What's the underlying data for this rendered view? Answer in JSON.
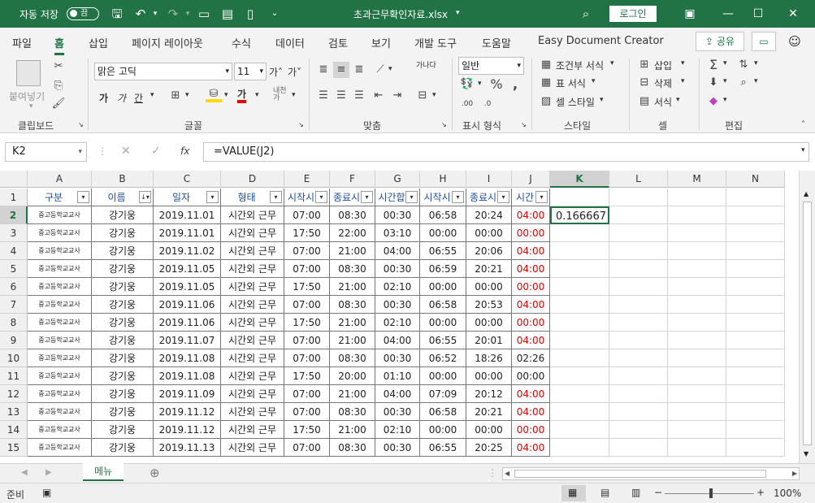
{
  "titlebar": {
    "autosave": "자동 저장",
    "autosave_state": "끔",
    "filename": "초과근무확인자료.xlsx",
    "login": "로그인"
  },
  "tabs": [
    "파일",
    "홈",
    "삽입",
    "페이지 레이아웃",
    "수식",
    "데이터",
    "검토",
    "보기",
    "개발 도구",
    "도움말",
    "Easy Document Creator"
  ],
  "share": "공유",
  "ribbon": {
    "paste": "붙여넣기",
    "font_name": "맑은 고딕",
    "font_size": "11",
    "bold": "가",
    "italic": "가",
    "underline": "간",
    "font_a": "가",
    "grow": "가˄",
    "shrink": "가˅",
    "numfmt": "일반",
    "wrap": "가나다",
    "cond": "조건부 서식",
    "tablefmt": "표 서식",
    "cellstyle": "셀 스타일",
    "insert": "삽입",
    "delete": "삭제",
    "format": "서식",
    "groups": {
      "clipboard": "클립보드",
      "font": "글꼴",
      "align": "맞춤",
      "number": "표시 형식",
      "style": "스타일",
      "cells": "셀",
      "edit": "편집"
    }
  },
  "namebox": "K2",
  "formula": "=VALUE(J2)",
  "columns": [
    "A",
    "B",
    "C",
    "D",
    "E",
    "F",
    "G",
    "H",
    "I",
    "J",
    "K",
    "L",
    "M",
    "N"
  ],
  "headers": [
    "구분",
    "이름",
    "일자",
    "형태",
    "시작시",
    "종료시",
    "시간합",
    "시작시",
    "종료시",
    "시간"
  ],
  "rows": [
    {
      "n": "1"
    },
    {
      "n": "2",
      "a": "중고등학교교사",
      "b": "강기웅",
      "c": "2019.11.01",
      "d": "시간외 근무",
      "e": "07:00",
      "f": "08:30",
      "g": "00:30",
      "h": "06:58",
      "i": "20:24",
      "j": "04:00",
      "jred": true,
      "k": "0.166667"
    },
    {
      "n": "3",
      "a": "중고등학교교사",
      "b": "강기웅",
      "c": "2019.11.01",
      "d": "시간외 근무",
      "e": "17:50",
      "f": "22:00",
      "g": "03:10",
      "h": "00:00",
      "i": "00:00",
      "j": "00:00",
      "jred": true
    },
    {
      "n": "4",
      "a": "중고등학교교사",
      "b": "강기웅",
      "c": "2019.11.02",
      "d": "시간외 근무",
      "e": "07:00",
      "f": "21:00",
      "g": "04:00",
      "h": "06:55",
      "i": "20:06",
      "j": "04:00",
      "jred": true
    },
    {
      "n": "5",
      "a": "중고등학교교사",
      "b": "강기웅",
      "c": "2019.11.05",
      "d": "시간외 근무",
      "e": "07:00",
      "f": "08:30",
      "g": "00:30",
      "h": "06:59",
      "i": "20:21",
      "j": "04:00",
      "jred": true
    },
    {
      "n": "6",
      "a": "중고등학교교사",
      "b": "강기웅",
      "c": "2019.11.05",
      "d": "시간외 근무",
      "e": "17:50",
      "f": "21:00",
      "g": "02:10",
      "h": "00:00",
      "i": "00:00",
      "j": "00:00",
      "jred": true
    },
    {
      "n": "7",
      "a": "중고등학교교사",
      "b": "강기웅",
      "c": "2019.11.06",
      "d": "시간외 근무",
      "e": "07:00",
      "f": "08:30",
      "g": "00:30",
      "h": "06:58",
      "i": "20:53",
      "j": "04:00",
      "jred": true
    },
    {
      "n": "8",
      "a": "중고등학교교사",
      "b": "강기웅",
      "c": "2019.11.06",
      "d": "시간외 근무",
      "e": "17:50",
      "f": "21:00",
      "g": "02:10",
      "h": "00:00",
      "i": "00:00",
      "j": "00:00",
      "jred": true
    },
    {
      "n": "9",
      "a": "중고등학교교사",
      "b": "강기웅",
      "c": "2019.11.07",
      "d": "시간외 근무",
      "e": "07:00",
      "f": "21:00",
      "g": "04:00",
      "h": "06:55",
      "i": "20:01",
      "j": "04:00",
      "jred": true
    },
    {
      "n": "10",
      "a": "중고등학교교사",
      "b": "강기웅",
      "c": "2019.11.08",
      "d": "시간외 근무",
      "e": "07:00",
      "f": "08:30",
      "g": "00:30",
      "h": "06:52",
      "i": "18:26",
      "j": "02:26",
      "jred": false
    },
    {
      "n": "11",
      "a": "중고등학교교사",
      "b": "강기웅",
      "c": "2019.11.08",
      "d": "시간외 근무",
      "e": "17:50",
      "f": "20:00",
      "g": "01:10",
      "h": "00:00",
      "i": "00:00",
      "j": "00:00",
      "jred": false
    },
    {
      "n": "12",
      "a": "중고등학교교사",
      "b": "강기웅",
      "c": "2019.11.09",
      "d": "시간외 근무",
      "e": "07:00",
      "f": "21:00",
      "g": "04:00",
      "h": "07:09",
      "i": "20:12",
      "j": "04:00",
      "jred": true
    },
    {
      "n": "13",
      "a": "중고등학교교사",
      "b": "강기웅",
      "c": "2019.11.12",
      "d": "시간외 근무",
      "e": "07:00",
      "f": "08:30",
      "g": "00:30",
      "h": "06:58",
      "i": "20:21",
      "j": "04:00",
      "jred": true
    },
    {
      "n": "14",
      "a": "중고등학교교사",
      "b": "강기웅",
      "c": "2019.11.12",
      "d": "시간외 근무",
      "e": "17:50",
      "f": "21:00",
      "g": "02:10",
      "h": "00:00",
      "i": "00:00",
      "j": "00:00",
      "jred": true
    },
    {
      "n": "15",
      "a": "중고등학교교사",
      "b": "강기웅",
      "c": "2019.11.13",
      "d": "시간외 근무",
      "e": "07:00",
      "f": "08:30",
      "g": "00:30",
      "h": "06:55",
      "i": "20:25",
      "j": "04:00",
      "jred": true
    }
  ],
  "sheet_tab": "메뉴",
  "status": {
    "ready": "준비",
    "zoom": "100%"
  },
  "colors": {
    "accent": "#217346",
    "red": "#e00000",
    "header_text": "#1f4e9c"
  }
}
